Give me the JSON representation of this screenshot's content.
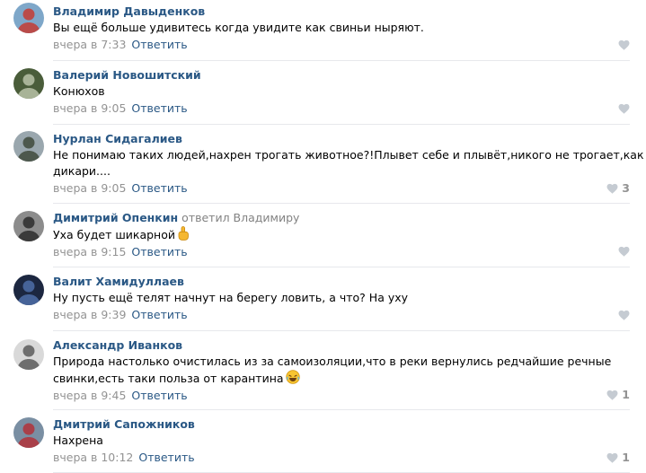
{
  "reply_label": "Ответить",
  "replied_word": "ответил",
  "colors": {
    "author": "#2a5885",
    "meta": "#939393",
    "separator": "#e7e8ec"
  },
  "comments": [
    {
      "author": "Владимир Давыденков",
      "text": [
        "Вы ещё больше удивитесь когда увидите как свиньи ныряют."
      ],
      "date": "вчера в 7:33",
      "likes": "",
      "avatar_colors": [
        "#7ea7c9",
        "#c43b32"
      ],
      "emoji": ""
    },
    {
      "author": "Валерий Новошитский",
      "text": [
        "Конюхов"
      ],
      "date": "вчера в 9:05",
      "likes": "",
      "avatar_colors": [
        "#4a5d3a",
        "#b8c2a8"
      ],
      "emoji": ""
    },
    {
      "author": "Нурлан Сидагалиев",
      "text": [
        "Не понимаю таких людей,нахрен трогать животное?!Плывет себе и плывёт,никого не трогает,как",
        "дикари...."
      ],
      "date": "вчера в 9:05",
      "likes": "3",
      "avatar_colors": [
        "#9aa7ae",
        "#3f4a3c"
      ],
      "emoji": ""
    },
    {
      "author": "Димитрий Опенкин",
      "reply_to": "Владимиру",
      "text": [
        "Уха будет шикарной"
      ],
      "date": "вчера в 9:15",
      "likes": "",
      "avatar_colors": [
        "#8c8c8c",
        "#2b2b2b"
      ],
      "emoji": "finger-up-emoji"
    },
    {
      "author": "Валит Хамидуллаев",
      "text": [
        "Ну пусть ещё телят начнут на берегу ловить, а что? На уху"
      ],
      "date": "вчера в 9:39",
      "likes": "",
      "avatar_colors": [
        "#1c2740",
        "#4e6fa8"
      ],
      "emoji": ""
    },
    {
      "author": "Александр Иванков",
      "text": [
        "Природа настолько очистилась из за самоизоляции,что в реки вернулись редчайшие речные",
        "свинки,есть таки польза от карантина"
      ],
      "date": "вчера в 9:45",
      "likes": "1",
      "avatar_colors": [
        "#d9d9d9",
        "#5a5a5a"
      ],
      "emoji": "laughing-emoji"
    },
    {
      "author": "Дмитрий Сапожников",
      "text": [
        "Нахрена"
      ],
      "date": "вчера в 10:12",
      "likes": "1",
      "avatar_colors": [
        "#7a8fa3",
        "#b2323a"
      ],
      "emoji": ""
    }
  ]
}
